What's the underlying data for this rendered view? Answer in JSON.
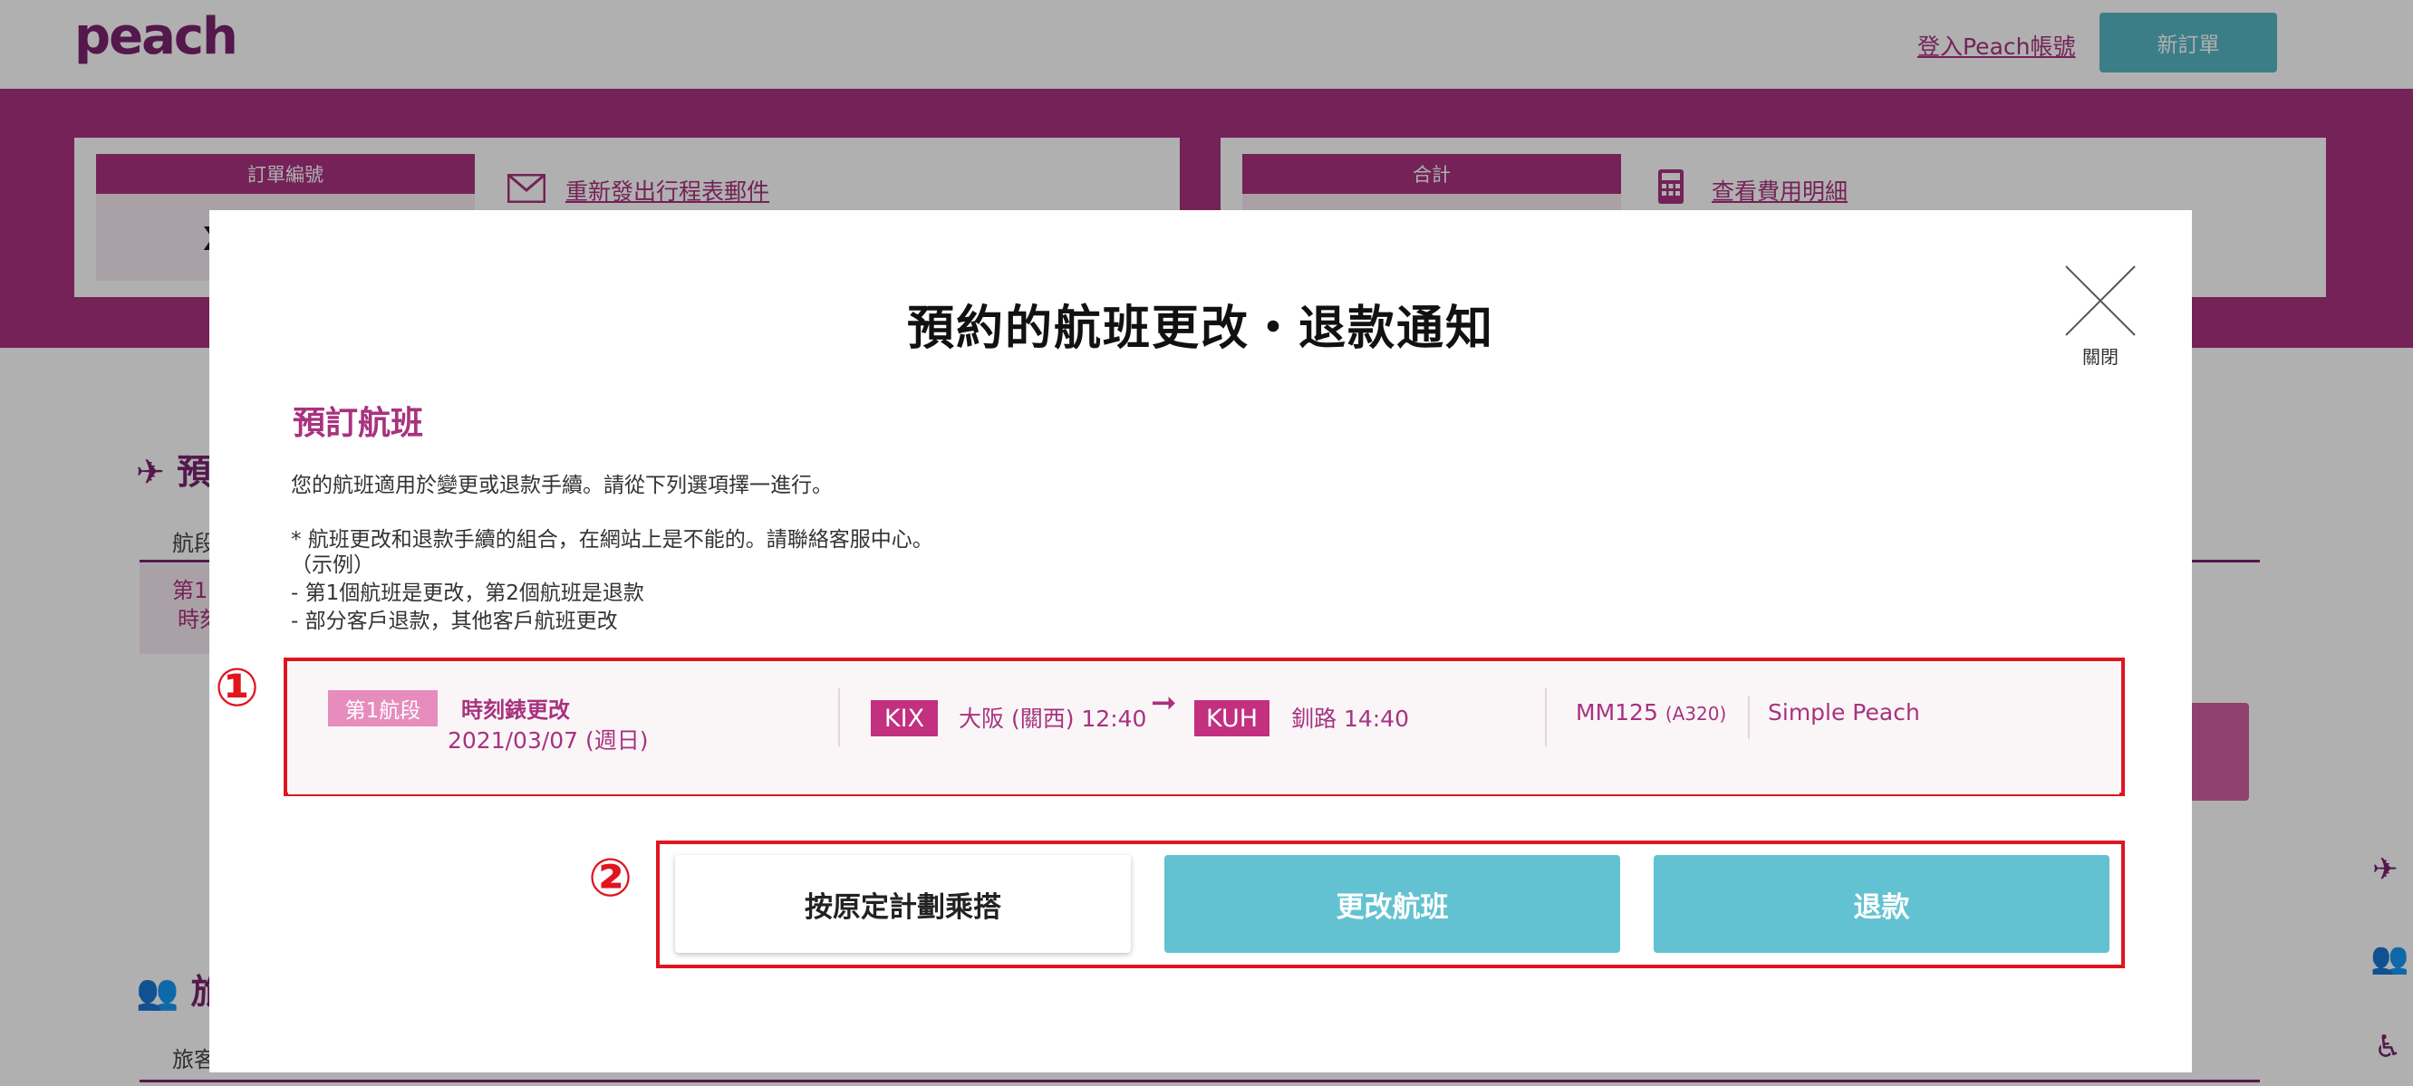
{
  "header": {
    "logo": "peach",
    "login_link": "登入Peach帳號",
    "new_order_button": "新訂單"
  },
  "summary": {
    "order_number_label": "訂單編號",
    "order_number_partial": "X",
    "resend_itinerary_link": "重新發出行程表郵件",
    "total_label": "合計",
    "view_fee_details_link": "查看費用明細"
  },
  "background_sections": {
    "flights_head_partial": "預",
    "leg_col_partial": "航段",
    "leg_cell_line1": "第1",
    "leg_cell_line2": "時刻",
    "travelers_head_partial": "旅",
    "travelers_col_partial": "旅客"
  },
  "modal": {
    "title": "預約的航班更改・退款通知",
    "close_label": "關閉",
    "section_title": "預訂航班",
    "intro_text": "您的航班適用於變更或退款手續。請從下列選項擇一進行。",
    "notice_lines": [
      "* 航班更改和退款手續的組合，在網站上是不能的。請聯絡客服中心。",
      "（示例）",
      "- 第1個航班是更改，第2個航班是退款",
      "- 部分客戶退款，其他客戶航班更改"
    ],
    "flight": {
      "leg_label": "第1航段",
      "status": "時刻錶更改",
      "date": "2021/03/07 (週日)",
      "origin_code": "KIX",
      "origin_info": "大阪 (關西) 12:40",
      "destination_code": "KUH",
      "destination_info": "釧路 14:40",
      "flight_number": "MM125",
      "aircraft": "(A320)",
      "fare_type": "Simple Peach"
    },
    "buttons": {
      "keep_original": "按原定計劃乘搭",
      "change_flight": "更改航班",
      "refund": "退款"
    }
  },
  "annotations": {
    "marker_1": "①",
    "marker_2": "②",
    "color": "#e0151e"
  },
  "colors": {
    "brand_purple": "#a8327f",
    "teal_button": "#62c2d1",
    "leg_tag": "#e68dbd",
    "airport_tag": "#c2307f"
  }
}
